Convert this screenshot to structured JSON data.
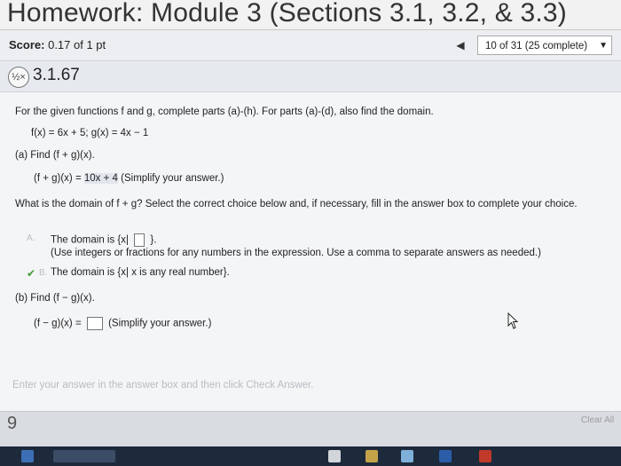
{
  "header": {
    "title": "Homework: Module 3 (Sections 3.1, 3.2, & 3.3)"
  },
  "score": {
    "label": "Score:",
    "value": "0.17 of 1 pt"
  },
  "navigation": {
    "prev_icon": "left-triangle-icon",
    "position": "10 of 31 (25 complete)",
    "dropdown_icon": "down-triangle-icon"
  },
  "question": {
    "status_icon": "partial-credit-icon",
    "status_symbol": "½×",
    "number": "3.1.67",
    "prompt": "For the given functions f and g, complete parts (a)-(h). For parts (a)-(d), also find the domain.",
    "functions": "f(x) = 6x + 5; g(x) = 4x − 1",
    "part_a": {
      "label": "(a) Find (f + g)(x).",
      "answer_prefix": "(f + g)(x) =",
      "answer_value": "10x + 4",
      "answer_hint": "(Simplify your answer.)",
      "domain_question": "What is the domain of f + g? Select the correct choice below and, if necessary, fill in the answer box to complete your choice.",
      "choice_a_letter": "A.",
      "choice_a_text_prefix": "The domain is {x|",
      "choice_a_text_suffix": "}.",
      "choice_a_hint": "(Use integers or fractions for any numbers in the expression. Use a comma to separate answers as needed.)",
      "choice_b_letter": "B.",
      "choice_b_mark": "✔",
      "choice_b_text": "The domain is {x| x is any real number}."
    },
    "part_b": {
      "label": "(b) Find (f − g)(x).",
      "answer_prefix": "(f − g)(x) =",
      "answer_hint": "(Simplify your answer.)"
    }
  },
  "footer": {
    "instruction": "Enter your answer in the answer box and then click Check Answer.",
    "parts_remaining": "9",
    "clear_all": "Clear All"
  }
}
